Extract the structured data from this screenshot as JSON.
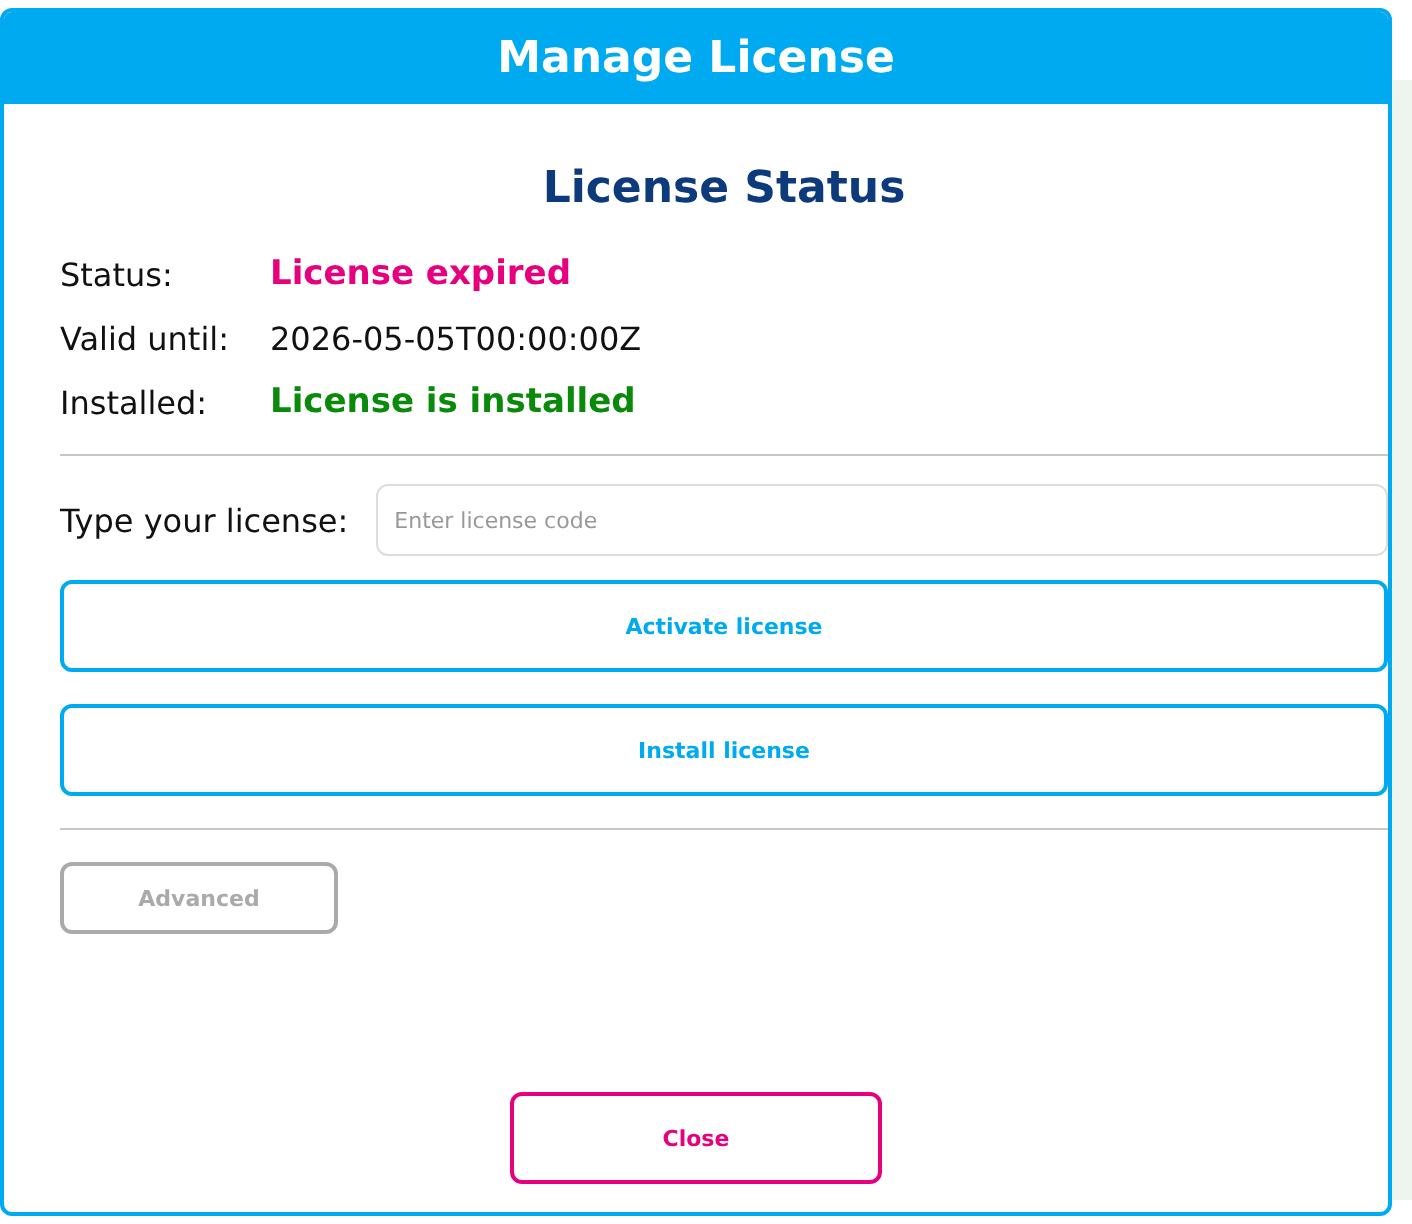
{
  "dialog": {
    "title": "Manage License",
    "heading": "License Status",
    "rows": [
      {
        "label": "Status:",
        "value": "License expired",
        "kind": "error"
      },
      {
        "label": "Valid until:",
        "value": "2026-05-05T00:00:00Z",
        "kind": "plain"
      },
      {
        "label": "Installed:",
        "value": "License is installed",
        "kind": "ok"
      }
    ],
    "license_field": {
      "label": "Type your license:",
      "placeholder": "Enter license code"
    },
    "buttons": [
      {
        "label": "Activate license",
        "disabled": false
      },
      {
        "label": "Install license",
        "disabled": false
      }
    ],
    "advanced": {
      "label": "Advanced",
      "disabled": true
    },
    "close": {
      "label": "Close"
    }
  }
}
